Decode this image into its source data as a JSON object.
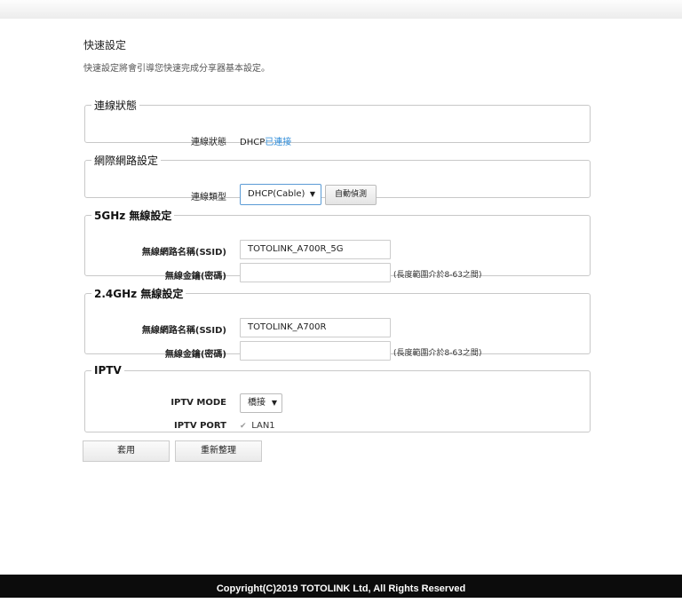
{
  "page": {
    "title": "快速設定",
    "description": "快速設定將會引導您快速完成分享器基本設定。"
  },
  "connection_status": {
    "legend": "連線狀態",
    "label": "連線狀態",
    "value_prefix": "DHCP",
    "value_status": "已連接"
  },
  "internet": {
    "legend": "網際網路設定",
    "type_label": "連線類型",
    "type_value": "DHCP(Cable)",
    "detect_button": "自動偵測"
  },
  "wifi5g": {
    "legend": "5GHz 無線設定",
    "ssid_label": "無線網路名稱(SSID)",
    "ssid_value": "TOTOLINK_A700R_5G",
    "key_label": "無線金鑰(密碼)",
    "key_value": "",
    "key_hint": "(長度範圍介於8-63之間)"
  },
  "wifi24g": {
    "legend": "2.4GHz 無線設定",
    "ssid_label": "無線網路名稱(SSID)",
    "ssid_value": "TOTOLINK_A700R",
    "key_label": "無線金鑰(密碼)",
    "key_value": "",
    "key_hint": "(長度範圍介於8-63之間)"
  },
  "iptv": {
    "legend": "IPTV",
    "mode_label": "IPTV MODE",
    "mode_value": "橋接",
    "port_label": "IPTV PORT",
    "port_option": "LAN1",
    "port_checked": true
  },
  "actions": {
    "apply": "套用",
    "refresh": "重新整理"
  },
  "footer": {
    "copyright": "Copyright(C)2019 TOTOLINK Ltd, All Rights Reserved"
  },
  "colors": {
    "link": "#2a8ad8",
    "footer_bg": "#0c0c0c"
  },
  "icons": {
    "dropdown": "triangle-down",
    "checkbox": "check-mark"
  }
}
